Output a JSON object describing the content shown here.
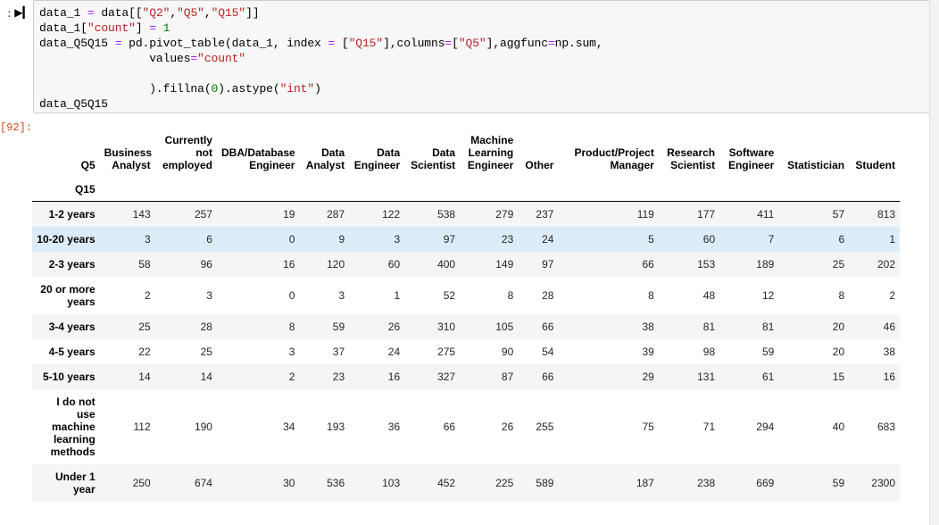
{
  "cell": {
    "in_prompt": ":",
    "run_icon": "run-cell-icon",
    "out_prompt": "[92]:",
    "code_lines": [
      "data_1 = data[[\"Q2\",\"Q5\",\"Q15\"]]",
      "data_1[\"count\"] = 1",
      "data_Q5Q15 = pd.pivot_table(data_1, index = [\"Q15\"],columns=[\"Q5\"],aggfunc=np.sum,",
      "                values=\"count\"",
      "",
      "                ).fillna(0).astype(\"int\")",
      "data_Q5Q15"
    ]
  },
  "table": {
    "columns_axis_name": "Q5",
    "index_axis_name": "Q15",
    "columns": [
      "Business Analyst",
      "Currently not employed",
      "DBA/Database Engineer",
      "Data Analyst",
      "Data Engineer",
      "Data Scientist",
      "Machine Learning Engineer",
      "Other",
      "Product/Project Manager",
      "Research Scientist",
      "Software Engineer",
      "Statistician",
      "Student"
    ],
    "rows": [
      {
        "index": "1-2 years",
        "highlight": false,
        "values": [
          143,
          257,
          19,
          287,
          122,
          538,
          279,
          237,
          119,
          177,
          411,
          57,
          813
        ]
      },
      {
        "index": "10-20 years",
        "highlight": true,
        "values": [
          3,
          6,
          0,
          9,
          3,
          97,
          23,
          24,
          5,
          60,
          7,
          6,
          1
        ]
      },
      {
        "index": "2-3 years",
        "highlight": false,
        "values": [
          58,
          96,
          16,
          120,
          60,
          400,
          149,
          97,
          66,
          153,
          189,
          25,
          202
        ]
      },
      {
        "index": "20 or more years",
        "highlight": false,
        "values": [
          2,
          3,
          0,
          3,
          1,
          52,
          8,
          28,
          8,
          48,
          12,
          8,
          2
        ]
      },
      {
        "index": "3-4 years",
        "highlight": false,
        "values": [
          25,
          28,
          8,
          59,
          26,
          310,
          105,
          66,
          38,
          81,
          81,
          20,
          46
        ]
      },
      {
        "index": "4-5 years",
        "highlight": false,
        "values": [
          22,
          25,
          3,
          37,
          24,
          275,
          90,
          54,
          39,
          98,
          59,
          20,
          38
        ]
      },
      {
        "index": "5-10 years",
        "highlight": false,
        "values": [
          14,
          14,
          2,
          23,
          16,
          327,
          87,
          66,
          29,
          131,
          61,
          15,
          16
        ]
      },
      {
        "index": "I do not use machine learning methods",
        "highlight": false,
        "values": [
          112,
          190,
          34,
          193,
          36,
          66,
          26,
          255,
          75,
          71,
          294,
          40,
          683
        ]
      },
      {
        "index": "Under 1 year",
        "highlight": false,
        "values": [
          250,
          674,
          30,
          536,
          103,
          452,
          225,
          589,
          187,
          238,
          669,
          59,
          2300
        ]
      }
    ]
  },
  "colors": {
    "highlight_row": "#ddecf9",
    "stripe": "#f5f5f5",
    "prompt_out": "#D84315",
    "prompt_in": "#303F9F",
    "string_token": "#BA2121",
    "number_token": "#008000",
    "operator_token": "#AA22FF"
  }
}
